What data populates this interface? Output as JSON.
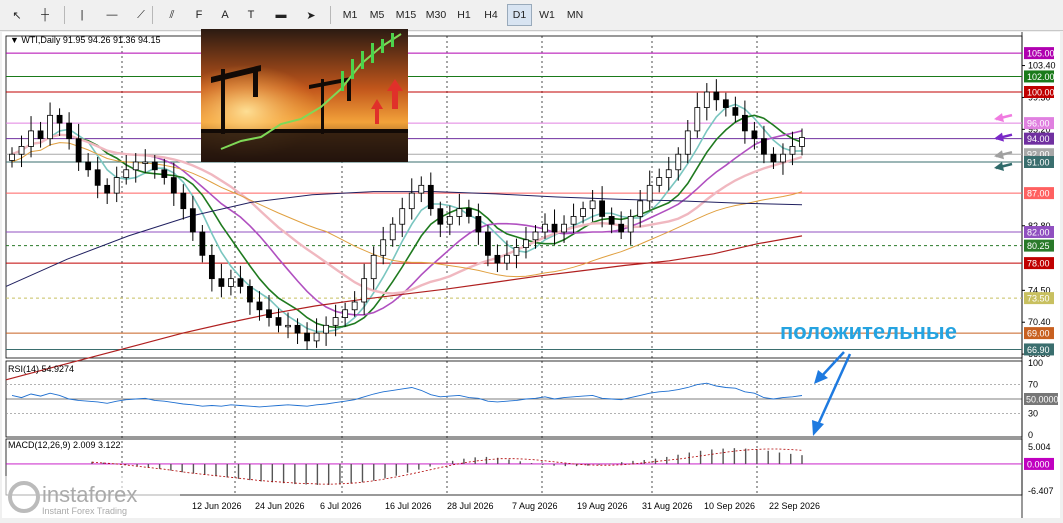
{
  "toolbar": {
    "tools": [
      {
        "name": "cursor-icon",
        "glyph": "↖"
      },
      {
        "name": "crosshair-icon",
        "glyph": "┼"
      },
      {
        "name": "vertical-line-icon",
        "glyph": "|"
      },
      {
        "name": "horizontal-line-icon",
        "glyph": "—"
      },
      {
        "name": "trend-line-icon",
        "glyph": "⟋"
      },
      {
        "name": "channel-icon",
        "glyph": "⫽"
      },
      {
        "name": "fibonacci-icon",
        "glyph": "F"
      },
      {
        "name": "text-tool-icon",
        "glyph": "A"
      },
      {
        "name": "text-label-icon",
        "glyph": "T"
      },
      {
        "name": "shapes-icon",
        "glyph": "▬"
      },
      {
        "name": "arrows-icon",
        "glyph": "➤"
      }
    ],
    "timeframes": [
      "M1",
      "M5",
      "M15",
      "M30",
      "H1",
      "H4",
      "D1",
      "W1",
      "MN"
    ],
    "active_timeframe": "D1"
  },
  "chart_data": [
    {
      "type": "candlestick",
      "title": "WTI,Daily  91.95 94.26 91.36 94.15",
      "symbol": "WTI",
      "timeframe": "Daily",
      "ohlc": {
        "open": 91.95,
        "high": 94.26,
        "low": 91.36,
        "close": 94.15
      },
      "ylim": [
        65.8,
        107.2
      ],
      "x_tick_labels": [
        "12 Jun 2026",
        "24 Jun 2026",
        "6 Jul 2026",
        "16 Jul 2026",
        "28 Jul 2026",
        "7 Aug 2026",
        "19 Aug 2026",
        "31 Aug 2026",
        "10 Sep 2026",
        "22 Sep 2026"
      ],
      "y_axis_labels": [
        "103.40",
        "99.30",
        "95.20",
        "82.80",
        "74.50",
        "70.40",
        "66.30"
      ],
      "level_tags": [
        {
          "value": "105.00",
          "color": "#b000b0"
        },
        {
          "value": "102.00",
          "color": "#1a7a1a"
        },
        {
          "value": "100.00",
          "color": "#c00000"
        },
        {
          "value": "96.00",
          "color": "#e080e0"
        },
        {
          "value": "94.00",
          "color": "#7030a0"
        },
        {
          "value": "92.00",
          "color": "#a8a8a8"
        },
        {
          "value": "91.00",
          "color": "#3a6e6e"
        },
        {
          "value": "87.00",
          "color": "#ff6060"
        },
        {
          "value": "82.00",
          "color": "#9050c0"
        },
        {
          "value": "80.25",
          "color": "#2a7a2a"
        },
        {
          "value": "78.00",
          "color": "#c00000"
        },
        {
          "value": "73.50",
          "color": "#c8c060"
        },
        {
          "value": "69.00",
          "color": "#c86020"
        },
        {
          "value": "66.90",
          "color": "#3a6e6e"
        }
      ],
      "close_series": [
        92,
        93,
        95,
        94,
        97,
        96,
        94,
        91,
        90,
        88,
        87,
        89,
        90,
        91,
        91,
        90,
        89,
        87,
        85,
        82,
        79,
        76,
        75,
        76,
        75,
        73,
        72,
        71,
        70,
        70,
        69,
        68,
        69,
        70,
        71,
        72,
        73,
        76,
        79,
        81,
        83,
        85,
        87,
        88,
        85,
        83,
        84,
        85,
        84,
        82,
        79,
        78,
        79,
        80,
        81,
        82,
        83,
        82,
        83,
        84,
        85,
        86,
        84,
        83,
        82,
        84,
        86,
        88,
        89,
        90,
        92,
        95,
        98,
        100,
        99,
        98,
        97,
        95,
        94,
        92,
        91,
        92,
        93,
        94.15
      ],
      "annotation_text": "положительные"
    },
    {
      "type": "line",
      "title": "RSI(14) 54.9274",
      "y_axis_labels": [
        "100",
        "70",
        "50.0000",
        "30",
        "0"
      ],
      "ylim": [
        0,
        100
      ],
      "values": [
        55,
        52,
        57,
        54,
        58,
        55,
        50,
        48,
        47,
        46,
        44,
        47,
        49,
        50,
        51,
        48,
        47,
        45,
        43,
        42,
        40,
        41,
        40,
        42,
        41,
        40,
        39,
        40,
        41,
        42,
        41,
        40,
        42,
        43,
        45,
        47,
        49,
        53,
        57,
        60,
        62,
        64,
        66,
        62,
        56,
        53,
        54,
        55,
        52,
        51,
        47,
        46,
        47,
        48,
        50,
        51,
        53,
        50,
        52,
        53,
        54,
        55,
        51,
        50,
        49,
        52,
        55,
        58,
        60,
        61,
        63,
        66,
        70,
        72,
        68,
        66,
        65,
        60,
        58,
        52,
        50,
        52,
        53,
        54.93
      ]
    },
    {
      "type": "bar",
      "title": "MACD(12,26,9) 2.009 3.122",
      "y_axis_labels": [
        "5.004",
        "0.000",
        "-6.407"
      ],
      "ylim": [
        -6.407,
        5.004
      ],
      "histogram": [
        0.5,
        0.3,
        0.1,
        -0.2,
        -0.5,
        -0.8,
        -1.1,
        -1.5,
        -1.9,
        -2.2,
        -2.5,
        -2.8,
        -3.1,
        -3.4,
        -3.7,
        -4.0,
        -4.2,
        -4.4,
        -4.6,
        -4.7,
        -4.8,
        -4.8,
        -4.7,
        -4.5,
        -4.2,
        -3.8,
        -3.3,
        -2.7,
        -2.0,
        -1.3,
        -0.6,
        0.1,
        0.7,
        1.2,
        1.5,
        1.6,
        1.4,
        1.0,
        0.6,
        0.2,
        -0.2,
        -0.4,
        -0.5,
        -0.5,
        -0.4,
        -0.2,
        0.1,
        0.4,
        0.7,
        0.9,
        1.2,
        1.6,
        2.1,
        2.6,
        3.0,
        3.3,
        3.5,
        3.6,
        3.5,
        3.3,
        3.0,
        2.6,
        2.3,
        2.0
      ],
      "signal": [
        0.4,
        0.2,
        0.0,
        -0.3,
        -0.6,
        -0.9,
        -1.2,
        -1.6,
        -2.0,
        -2.3,
        -2.6,
        -2.9,
        -3.2,
        -3.5,
        -3.8,
        -4.0,
        -4.2,
        -4.4,
        -4.5,
        -4.6,
        -4.6,
        -4.5,
        -4.3,
        -4.0,
        -3.6,
        -3.1,
        -2.6,
        -2.0,
        -1.4,
        -0.8,
        -0.2,
        0.3,
        0.7,
        1.0,
        1.2,
        1.2,
        1.1,
        0.9,
        0.6,
        0.3,
        0.0,
        -0.2,
        -0.3,
        -0.3,
        -0.2,
        0.0,
        0.3,
        0.6,
        0.9,
        1.2,
        1.6,
        2.0,
        2.4,
        2.8,
        3.1,
        3.3,
        3.4,
        3.4,
        3.3,
        3.1
      ]
    }
  ],
  "watermark": {
    "brand": "instaforex",
    "tagline": "Instant Forex Trading"
  }
}
